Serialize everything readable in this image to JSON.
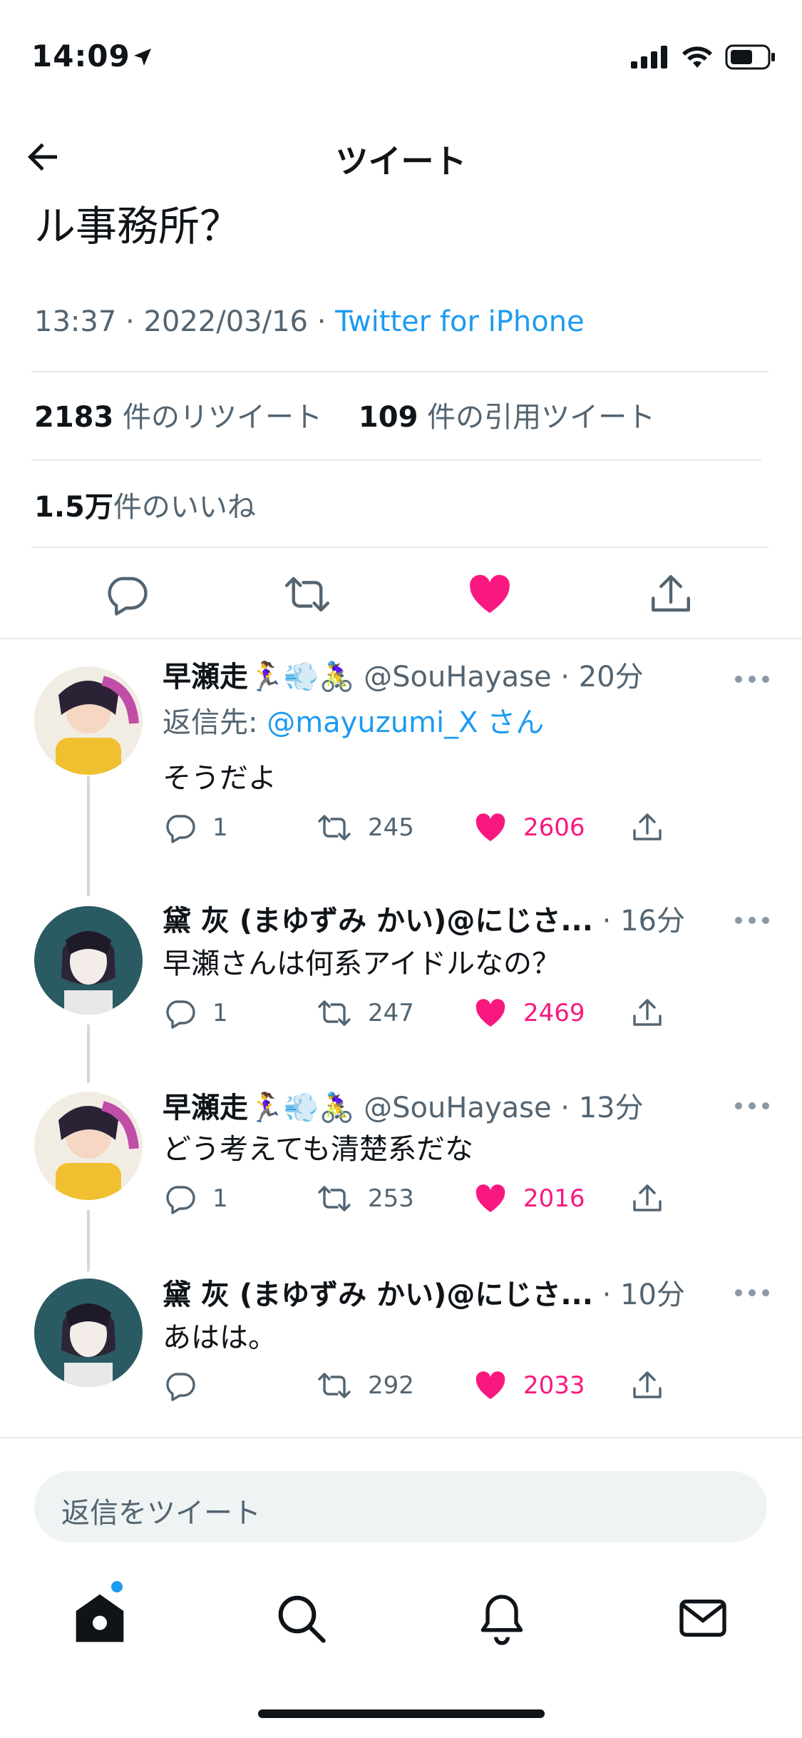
{
  "status_bar": {
    "time": "14:09"
  },
  "header": {
    "title": "ツイート"
  },
  "tweet": {
    "text_tail": "ル事務所？",
    "time": "13:37",
    "date": "2022/03/16",
    "source": "Twitter for iPhone",
    "sep": " · ",
    "retweet_count": "2183",
    "retweet_label": "件のリツイート",
    "quote_count": "109",
    "quote_label": "件の引用ツイート",
    "like_count": "1.5万",
    "like_label": "件のいいね"
  },
  "replies": [
    {
      "name": "早瀬走🏃‍♀️💨🚴‍♀️",
      "handle": "@SouHayase",
      "time": "20分",
      "reply_to_prefix": "返信先: ",
      "reply_to_mention": "@mayuzumi_X",
      "reply_to_suffix": " さん",
      "text": "そうだよ",
      "replies": "1",
      "retweets": "245",
      "likes": "2606"
    },
    {
      "name": "黛 灰 (まゆずみ かい)@にじさ...",
      "handle": "",
      "time": "16分",
      "text": "早瀬さんは何系アイドルなの？",
      "replies": "1",
      "retweets": "247",
      "likes": "2469"
    },
    {
      "name": "早瀬走🏃‍♀️💨🚴‍♀️",
      "handle": "@SouHayase",
      "time": "13分",
      "text": "どう考えても清楚系だな",
      "replies": "1",
      "retweets": "253",
      "likes": "2016"
    },
    {
      "name": "黛 灰 (まゆずみ かい)@にじさ...",
      "handle": "",
      "time": "10分",
      "text": "あはは。",
      "replies": "",
      "retweets": "292",
      "likes": "2033"
    }
  ],
  "composer": {
    "placeholder": "返信をツイート"
  },
  "colors": {
    "accent": "#1d9bf0",
    "like": "#f91880",
    "text": "#0f1419",
    "muted": "#536471"
  },
  "icons": [
    "back-arrow-icon",
    "reply-icon",
    "retweet-icon",
    "heart-icon",
    "share-icon",
    "more-icon",
    "home-icon",
    "search-icon",
    "bell-icon",
    "mail-icon"
  ]
}
